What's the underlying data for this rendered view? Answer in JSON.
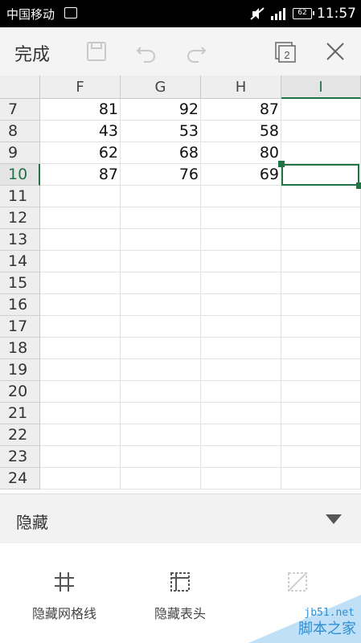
{
  "status_bar": {
    "carrier": "中国移动",
    "battery": "62",
    "time": "11:57"
  },
  "toolbar": {
    "done_label": "完成",
    "page_count": "2"
  },
  "columns": [
    "F",
    "G",
    "H",
    "I"
  ],
  "active_column": "I",
  "rows": [
    {
      "num": "7",
      "cells": [
        "81",
        "92",
        "87",
        ""
      ]
    },
    {
      "num": "8",
      "cells": [
        "43",
        "53",
        "58",
        ""
      ]
    },
    {
      "num": "9",
      "cells": [
        "62",
        "68",
        "80",
        ""
      ]
    },
    {
      "num": "10",
      "cells": [
        "87",
        "76",
        "69",
        ""
      ],
      "active": true
    },
    {
      "num": "11",
      "cells": [
        "",
        "",
        "",
        ""
      ]
    },
    {
      "num": "12",
      "cells": [
        "",
        "",
        "",
        ""
      ]
    },
    {
      "num": "13",
      "cells": [
        "",
        "",
        "",
        ""
      ]
    },
    {
      "num": "14",
      "cells": [
        "",
        "",
        "",
        ""
      ]
    },
    {
      "num": "15",
      "cells": [
        "",
        "",
        "",
        ""
      ]
    },
    {
      "num": "16",
      "cells": [
        "",
        "",
        "",
        ""
      ]
    },
    {
      "num": "17",
      "cells": [
        "",
        "",
        "",
        ""
      ]
    },
    {
      "num": "18",
      "cells": [
        "",
        "",
        "",
        ""
      ]
    },
    {
      "num": "19",
      "cells": [
        "",
        "",
        "",
        ""
      ]
    },
    {
      "num": "20",
      "cells": [
        "",
        "",
        "",
        ""
      ]
    },
    {
      "num": "21",
      "cells": [
        "",
        "",
        "",
        ""
      ]
    },
    {
      "num": "22",
      "cells": [
        "",
        "",
        "",
        ""
      ]
    },
    {
      "num": "23",
      "cells": [
        "",
        "",
        "",
        ""
      ]
    },
    {
      "num": "24",
      "cells": [
        "",
        "",
        "",
        ""
      ]
    }
  ],
  "hide_panel": {
    "title": "隐藏",
    "options": [
      {
        "label": "隐藏网格线",
        "icon": "grid-icon"
      },
      {
        "label": "隐藏表头",
        "icon": "header-icon"
      },
      {
        "label": "",
        "icon": "disabled-icon"
      }
    ]
  },
  "watermark": {
    "site": "jb51.net",
    "name": "脚本之家"
  },
  "colors": {
    "accent": "#217346",
    "header_bg": "#eeeeee"
  }
}
